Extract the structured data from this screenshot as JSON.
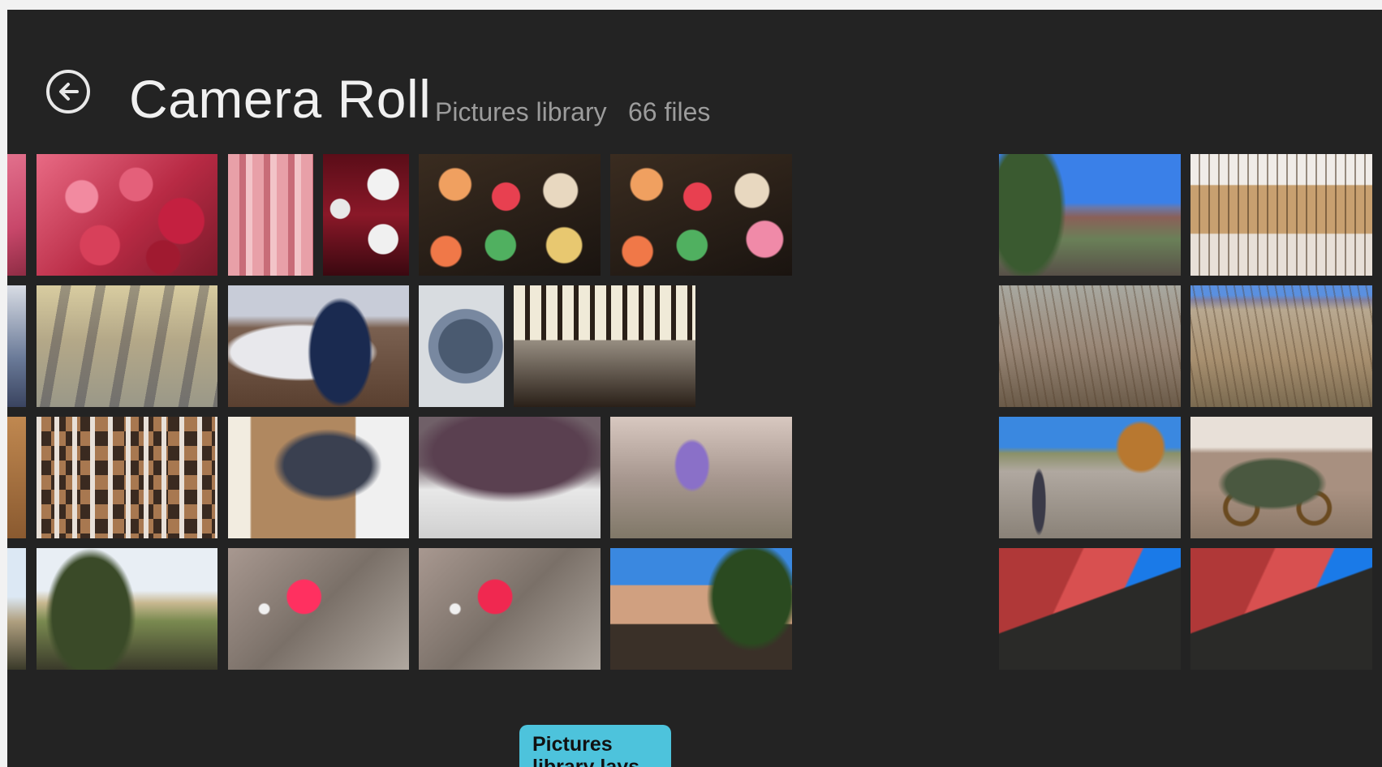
{
  "header": {
    "title": "Camera Roll",
    "location": "Pictures library",
    "count": "66 files"
  },
  "tooltip": {
    "text": "Pictures library lays"
  },
  "left_group": [
    {
      "name": "roses-edge",
      "alt": "pink roses (cropped)"
    },
    {
      "name": "red-roses",
      "alt": "bouquets of red and pink roses"
    },
    {
      "name": "wrapped-candy",
      "alt": "pink wrapped candy sticks"
    },
    {
      "name": "soda-bottles",
      "alt": "bottles with white caps"
    },
    {
      "name": "lollipops-1",
      "alt": "jar of round lollipops"
    },
    {
      "name": "lollipops-2",
      "alt": "jar of round lollipops"
    },
    {
      "name": "shadow-path-edge",
      "alt": "blue object (cropped)"
    },
    {
      "name": "shadow-path",
      "alt": "long shadows on gravel path"
    },
    {
      "name": "shadow-snow",
      "alt": "person's shadow over white rock"
    },
    {
      "name": "framed-square",
      "alt": "framed square artwork"
    },
    {
      "name": "dining-room",
      "alt": "dining room with tall windows"
    },
    {
      "name": "chess-edge",
      "alt": "chess pieces (cropped)"
    },
    {
      "name": "chess-board",
      "alt": "large chess board with pieces"
    },
    {
      "name": "wall-art",
      "alt": "wall art next to window"
    },
    {
      "name": "succulent-pot",
      "alt": "purple succulent in white pot"
    },
    {
      "name": "purple-flower",
      "alt": "purple flower in shrub"
    },
    {
      "name": "garden-edge",
      "alt": "garden (cropped)"
    },
    {
      "name": "garden-trees",
      "alt": "trees in a garden"
    },
    {
      "name": "red-flower-1",
      "alt": "red flower in shrub"
    },
    {
      "name": "red-flower-2",
      "alt": "red flower in shrub"
    },
    {
      "name": "adobe-house",
      "alt": "adobe house with tree"
    }
  ],
  "right_group": [
    {
      "name": "mountain-field",
      "alt": "field with distant mountains"
    },
    {
      "name": "adobe-building",
      "alt": "adobe building with windows"
    },
    {
      "name": "dry-grass-1",
      "alt": "dry grassland"
    },
    {
      "name": "dry-grass-2",
      "alt": "dry grassland with mountains"
    },
    {
      "name": "shadow-road",
      "alt": "shadow on dirt road with autumn tree"
    },
    {
      "name": "wagon",
      "alt": "old wooden wagon"
    },
    {
      "name": "red-boat-1",
      "alt": "red boat hull against blue sky"
    },
    {
      "name": "red-boat-2",
      "alt": "red boat hull against blue sky"
    }
  ]
}
